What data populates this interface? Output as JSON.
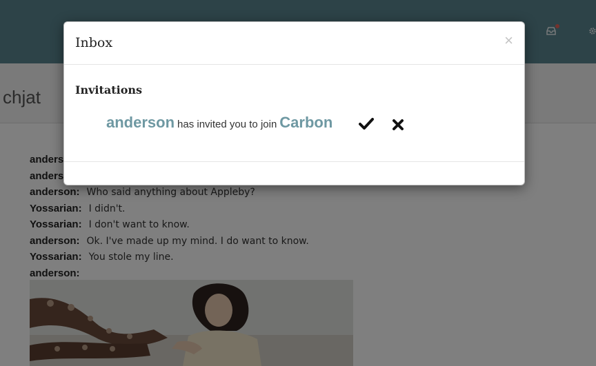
{
  "room": {
    "title": "chjat"
  },
  "messages": [
    {
      "author": "anderson:",
      "text": ""
    },
    {
      "author": "anderson:",
      "text": ""
    },
    {
      "author": "anderson:",
      "text": "Who said anything about Appleby?"
    },
    {
      "author": "Yossarian:",
      "text": "I didn't."
    },
    {
      "author": "Yossarian:",
      "text": "I don't want to know."
    },
    {
      "author": "anderson:",
      "text": "Ok. I've made up my mind. I do want to know."
    },
    {
      "author": "Yossarian:",
      "text": "You stole my line."
    },
    {
      "author": "anderson:",
      "text": ""
    }
  ],
  "topbar": {
    "icons": [
      "inbox-icon",
      "notification-dot",
      "gear-icon"
    ],
    "colors": {
      "bar": "#5b8791",
      "notification": "#e8635a"
    }
  },
  "modal": {
    "title": "Inbox",
    "close_glyph": "×",
    "section_title": "Invitations",
    "invitation": {
      "user": "anderson",
      "text": "has invited you to join",
      "room": "Carbon"
    },
    "accent_color": "#6e98a2"
  }
}
